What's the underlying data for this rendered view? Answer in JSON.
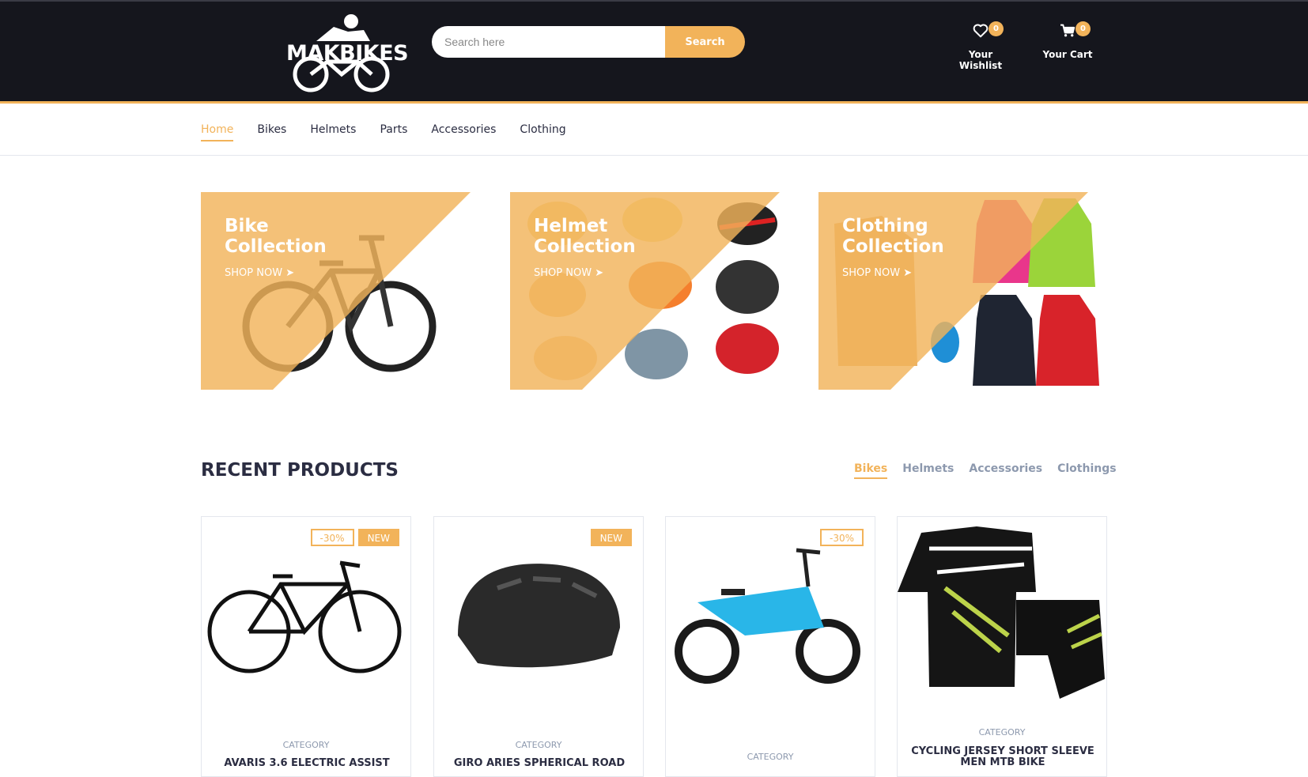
{
  "header": {
    "logo_text": "MAKBIKES",
    "search": {
      "placeholder": "Search here",
      "button_label": "Search"
    },
    "wishlist": {
      "label": "Your Wishlist",
      "count": "0",
      "icon": "heart-icon"
    },
    "cart": {
      "label": "Your Cart",
      "count": "0",
      "icon": "cart-icon"
    }
  },
  "nav": {
    "items": [
      {
        "label": "Home",
        "active": true
      },
      {
        "label": "Bikes"
      },
      {
        "label": "Helmets"
      },
      {
        "label": "Parts"
      },
      {
        "label": "Accessories"
      },
      {
        "label": "Clothing"
      }
    ]
  },
  "collections": [
    {
      "title_line1": "Bike",
      "title_line2": "Collection",
      "cta": "SHOP NOW"
    },
    {
      "title_line1": "Helmet",
      "title_line2": "Collection",
      "cta": "SHOP NOW"
    },
    {
      "title_line1": "Clothing",
      "title_line2": "Collection",
      "cta": "SHOP NOW"
    }
  ],
  "recent": {
    "title": "RECENT PRODUCTS",
    "tabs": [
      {
        "label": "Bikes",
        "active": true
      },
      {
        "label": "Helmets"
      },
      {
        "label": "Accessories"
      },
      {
        "label": "Clothings"
      }
    ],
    "products": [
      {
        "sale": "-30%",
        "new": "NEW",
        "category": "CATEGORY",
        "name": "AVARIS 3.6 ELECTRIC ASSIST"
      },
      {
        "new": "NEW",
        "category": "CATEGORY",
        "name": "GIRO ARIES SPHERICAL ROAD"
      },
      {
        "sale": "-30%",
        "category": "CATEGORY",
        "name": ""
      },
      {
        "category": "CATEGORY",
        "name": "CYCLING JERSEY SHORT SLEEVE MEN MTB BIKE"
      }
    ]
  },
  "colors": {
    "accent": "#f2b35a",
    "header_bg": "#15161d",
    "text": "#2b2d42",
    "muted": "#8d99ae"
  }
}
